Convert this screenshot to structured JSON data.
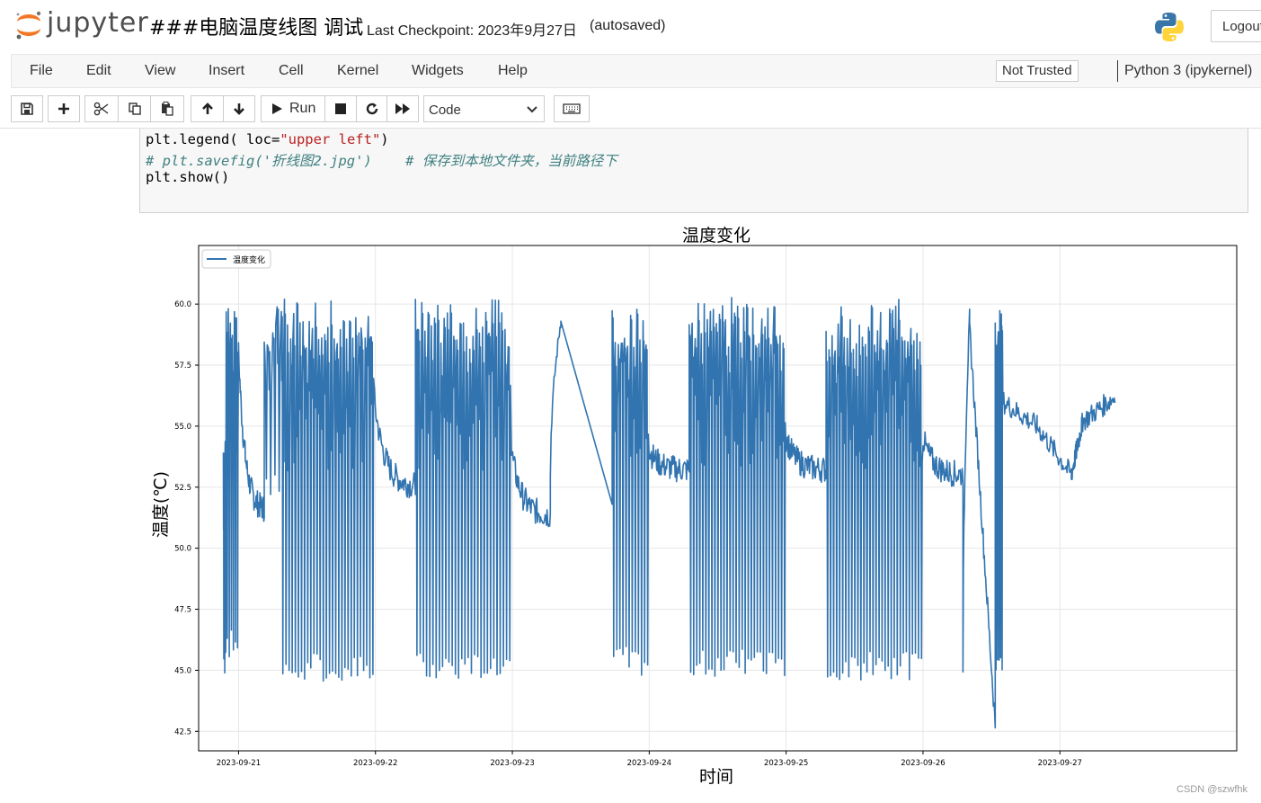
{
  "header": {
    "logo_text": "jupyter",
    "notebook_title": "###电脑温度线图 调试",
    "checkpoint": "Last Checkpoint: 2023年9月27日",
    "autosaved": "(autosaved)",
    "logout_label": "Logout"
  },
  "menubar": {
    "items": [
      "File",
      "Edit",
      "View",
      "Insert",
      "Cell",
      "Kernel",
      "Widgets",
      "Help"
    ],
    "trust_label": "Not Trusted",
    "kernel_label": "Python 3 (ipykernel)"
  },
  "toolbar": {
    "icons": [
      "save-icon",
      "plus-icon",
      "cut-icon",
      "copy-icon",
      "paste-icon",
      "arrow-up-icon",
      "arrow-down-icon",
      "run-icon",
      "stop-icon",
      "restart-icon",
      "fast-forward-icon",
      "keyboard-icon"
    ],
    "run_label": "Run",
    "cell_type": "Code"
  },
  "code": {
    "line1_a": "plt.legend( loc=",
    "line1_str": "\"upper left\"",
    "line1_b": ")",
    "line2": "# plt.savefig('折线图2.jpg')    # 保存到本地文件夹，当前路径下",
    "line3": "plt.show()"
  },
  "watermark": "CSDN @szwfhk",
  "colors": {
    "line": "#3274b0",
    "string": "#ba2121",
    "comment": "#408080"
  },
  "chart_data": {
    "type": "line",
    "title": "温度变化",
    "xlabel": "时间",
    "ylabel": "温度(℃)",
    "legend": "upper left",
    "grid": true,
    "xlim": [
      "2023-09-20 17:00",
      "2023-09-28 07:00"
    ],
    "ylim": [
      41.7,
      62.4
    ],
    "x_ticks": [
      "2023-09-21",
      "2023-09-22",
      "2023-09-23",
      "2023-09-24",
      "2023-09-25",
      "2023-09-26",
      "2023-09-27"
    ],
    "y_ticks": [
      "42.5",
      "45.0",
      "47.5",
      "50.0",
      "52.5",
      "55.0",
      "57.5",
      "60.0"
    ],
    "series": [
      {
        "name": "温度变化",
        "color": "#3274b0",
        "segments": [
          {
            "start": "2023-09-20 21:20",
            "end": "2023-09-20 21:50",
            "kind": "osc",
            "low": 44.8,
            "high": 55.0,
            "cycles": 3
          },
          {
            "start": "2023-09-20 21:50",
            "end": "2023-09-21 00:00",
            "kind": "osc",
            "low": 45.5,
            "high": 60.2,
            "cycles": 6
          },
          {
            "start": "2023-09-21 00:00",
            "end": "2023-09-21 04:30",
            "kind": "settle",
            "from": 58.0,
            "to": 51.5
          },
          {
            "start": "2023-09-21 04:30",
            "end": "2023-09-21 07:30",
            "kind": "osc",
            "low": 52.0,
            "high": 60.0,
            "cycles": 4
          },
          {
            "start": "2023-09-21 07:30",
            "end": "2023-09-21 23:50",
            "kind": "osc",
            "low": 44.5,
            "high": 60.2,
            "cycles": 30
          },
          {
            "start": "2023-09-21 23:50",
            "end": "2023-09-22 07:00",
            "kind": "settle",
            "from": 56.0,
            "to": 52.5
          },
          {
            "start": "2023-09-22 07:00",
            "end": "2023-09-22 23:50",
            "kind": "osc",
            "low": 44.6,
            "high": 60.2,
            "cycles": 30
          },
          {
            "start": "2023-09-22 23:50",
            "end": "2023-09-23 06:40",
            "kind": "settle",
            "from": 54.0,
            "to": 51.3
          },
          {
            "start": "2023-09-23 06:40",
            "end": "2023-09-23 08:30",
            "kind": "rise",
            "from": 53.0,
            "to": 59.3
          },
          {
            "start": "2023-09-23 08:30",
            "end": "2023-09-23 17:30",
            "kind": "linear",
            "from": 59.3,
            "to": 51.8
          },
          {
            "start": "2023-09-23 17:30",
            "end": "2023-09-24 00:00",
            "kind": "osc",
            "low": 44.8,
            "high": 60.0,
            "cycles": 12
          },
          {
            "start": "2023-09-24 00:00",
            "end": "2023-09-24 07:00",
            "kind": "settle",
            "from": 54.0,
            "to": 53.2
          },
          {
            "start": "2023-09-24 07:00",
            "end": "2023-09-25 00:00",
            "kind": "osc",
            "low": 44.7,
            "high": 60.4,
            "cycles": 32
          },
          {
            "start": "2023-09-25 00:00",
            "end": "2023-09-25 07:00",
            "kind": "settle",
            "from": 54.5,
            "to": 53.2
          },
          {
            "start": "2023-09-25 07:00",
            "end": "2023-09-26 00:00",
            "kind": "osc",
            "low": 44.6,
            "high": 60.2,
            "cycles": 32
          },
          {
            "start": "2023-09-26 00:00",
            "end": "2023-09-26 07:00",
            "kind": "settle",
            "from": 54.5,
            "to": 53.0
          },
          {
            "start": "2023-09-26 07:00",
            "end": "2023-09-26 08:10",
            "kind": "rise",
            "from": 45.2,
            "to": 59.5
          },
          {
            "start": "2023-09-26 08:10",
            "end": "2023-09-26 12:40",
            "kind": "linear",
            "from": 59.0,
            "to": 42.7
          },
          {
            "start": "2023-09-26 12:40",
            "end": "2023-09-26 14:00",
            "kind": "osc",
            "low": 45.0,
            "high": 59.8,
            "cycles": 5
          },
          {
            "start": "2023-09-26 14:00",
            "end": "2023-09-26 20:00",
            "kind": "linear",
            "from": 56.0,
            "to": 55.0
          },
          {
            "start": "2023-09-26 20:00",
            "end": "2023-09-27 02:00",
            "kind": "linear",
            "from": 55.0,
            "to": 53.0
          },
          {
            "start": "2023-09-27 02:00",
            "end": "2023-09-27 04:00",
            "kind": "linear",
            "from": 53.0,
            "to": 55.2
          },
          {
            "start": "2023-09-27 04:00",
            "end": "2023-09-27 09:40",
            "kind": "linear",
            "from": 55.2,
            "to": 56.2
          }
        ]
      }
    ]
  }
}
